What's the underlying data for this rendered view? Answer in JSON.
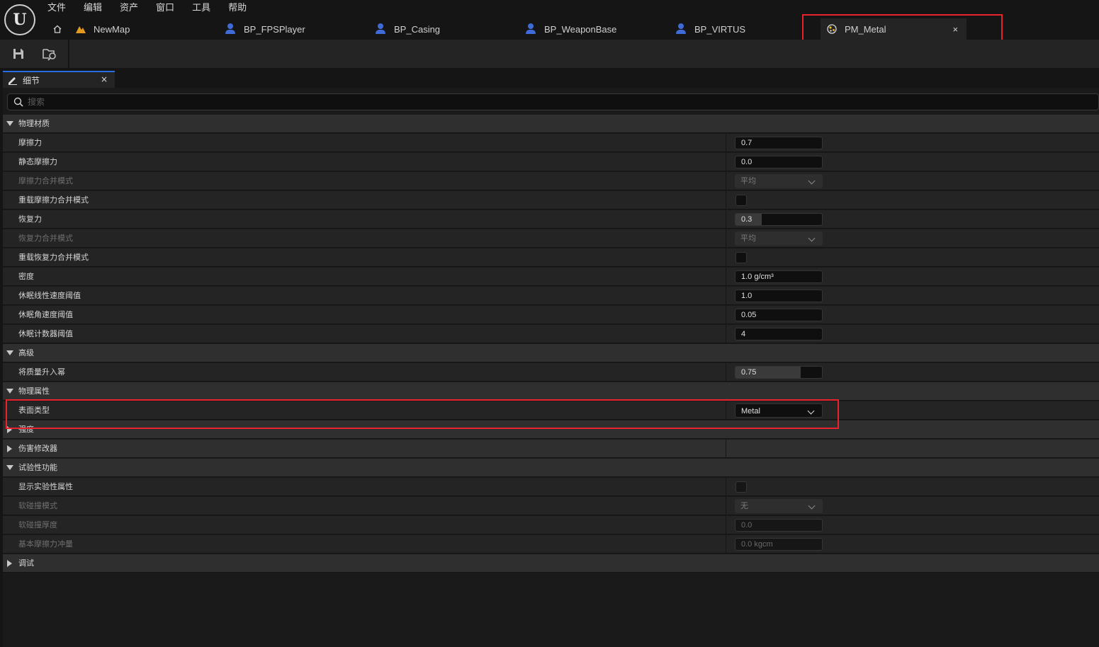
{
  "app": {
    "logo_letter": "U",
    "menu": [
      "文件",
      "编辑",
      "资产",
      "窗口",
      "工具",
      "帮助"
    ]
  },
  "tabs": [
    {
      "label": "NewMap",
      "icon": "level-map-icon"
    },
    {
      "label": "BP_FPSPlayer",
      "icon": "blueprint-icon"
    },
    {
      "label": "BP_Casing",
      "icon": "blueprint-icon"
    },
    {
      "label": "BP_WeaponBase",
      "icon": "blueprint-icon"
    },
    {
      "label": "BP_VIRTUS",
      "icon": "blueprint-icon"
    },
    {
      "label": "PM_Metal",
      "icon": "physical-material-icon",
      "active": true,
      "close": "×"
    }
  ],
  "toolbar": {
    "buttons": [
      "save-icon",
      "browse-to-asset-icon"
    ]
  },
  "details": {
    "tab_label": "细节",
    "tab_close": "×",
    "search_placeholder": "搜索",
    "sections": {
      "physical_material": "物理材质",
      "advanced": "高级",
      "physical_properties": "物理属性",
      "strength": "强度",
      "damage_modifier": "伤害修改器",
      "experimental": "试验性功能",
      "debug": "调试"
    },
    "props": {
      "friction": {
        "label": "摩擦力",
        "value": "0.7"
      },
      "static_friction": {
        "label": "静态摩擦力",
        "value": "0.0"
      },
      "friction_combine_mode": {
        "label": "摩擦力合并模式",
        "value": "平均"
      },
      "override_friction_combine_mode": {
        "label": "重载摩擦力合并模式",
        "checked": false
      },
      "restitution": {
        "label": "恢复力",
        "value": "0.3",
        "fill": 0.3
      },
      "restitution_combine_mode": {
        "label": "恢复力合并模式",
        "value": "平均"
      },
      "override_restitution_combine_mode": {
        "label": "重载恢复力合并模式",
        "checked": false
      },
      "density": {
        "label": "密度",
        "value": "1.0 g/cm³"
      },
      "sleep_linear_velocity_threshold": {
        "label": "休眠线性速度阈值",
        "value": "1.0"
      },
      "sleep_angular_velocity_threshold": {
        "label": "休眠角速度阈值",
        "value": "0.05"
      },
      "sleep_counter_threshold": {
        "label": "休眠计数器阈值",
        "value": "4"
      },
      "raise_mass_to_power": {
        "label": "将质量升入幂",
        "value": "0.75",
        "fill": 0.75
      },
      "surface_type": {
        "label": "表面类型",
        "value": "Metal"
      },
      "show_experimental_properties": {
        "label": "显示实验性属性",
        "checked": false
      },
      "soft_collision_mode": {
        "label": "软碰撞模式",
        "value": "无"
      },
      "soft_collision_thickness": {
        "label": "软碰撞厚度",
        "value": "0.0"
      },
      "base_friction_impulse": {
        "label": "基本摩擦力冲量",
        "value": "0.0 kgcm"
      }
    }
  },
  "colors": {
    "highlight_box": "#e8232b",
    "active_tab_accent": "#2a6de0",
    "blueprint_icon": "#3f6bd8",
    "level_icon": "#e39a1e"
  }
}
